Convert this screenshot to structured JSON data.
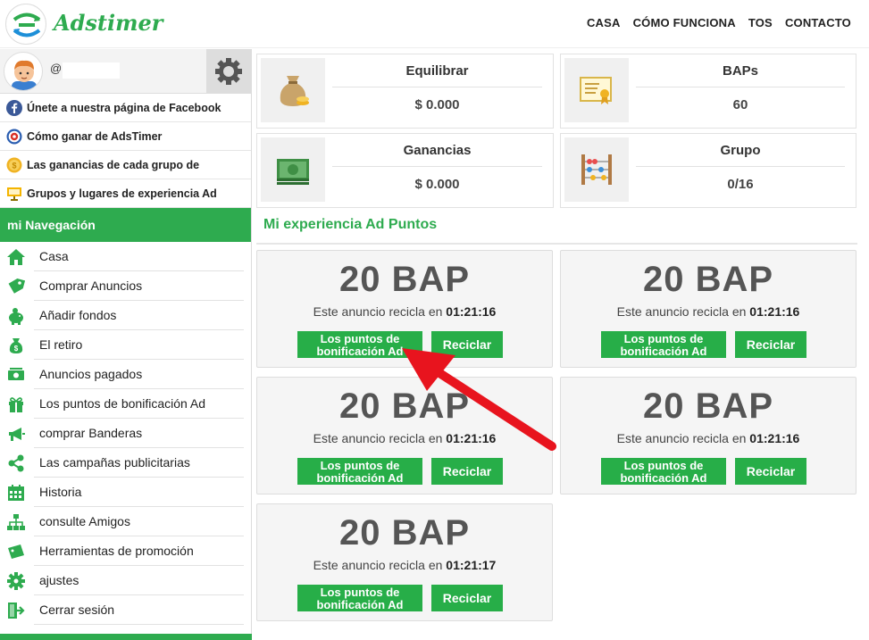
{
  "header": {
    "brand": "Adstimer",
    "nav": [
      "CASA",
      "CÓMO FUNCIONA",
      "TOS",
      "CONTACTO"
    ]
  },
  "profile": {
    "username_prefix": "@"
  },
  "promo_links": [
    {
      "label": "Únete a nuestra página de Facebook",
      "icon": "facebook-icon"
    },
    {
      "label": "Cómo ganar de AdsTimer",
      "icon": "target-icon"
    },
    {
      "label": "Las ganancias de cada grupo de",
      "icon": "coin-icon"
    },
    {
      "label": "Grupos y lugares de experiencia Ad",
      "icon": "presentation-icon"
    }
  ],
  "navigation": {
    "title": "mi Navegación",
    "items": [
      {
        "label": "Casa",
        "icon": "home-icon"
      },
      {
        "label": "Comprar Anuncios",
        "icon": "tag-icon"
      },
      {
        "label": "Añadir fondos",
        "icon": "piggy-bank-icon"
      },
      {
        "label": "El retiro",
        "icon": "money-bag-icon"
      },
      {
        "label": "Anuncios pagados",
        "icon": "cash-icon"
      },
      {
        "label": "Los puntos de bonificación Ad",
        "icon": "gift-icon"
      },
      {
        "label": "comprar Banderas",
        "icon": "megaphone-icon"
      },
      {
        "label": "Las campañas publicitarias",
        "icon": "share-icon"
      },
      {
        "label": "Historia",
        "icon": "calendar-icon"
      },
      {
        "label": "consulte Amigos",
        "icon": "sitemap-icon"
      },
      {
        "label": "Herramientas de promoción",
        "icon": "ticket-icon"
      },
      {
        "label": "ajustes",
        "icon": "cog-icon"
      },
      {
        "label": "Cerrar sesión",
        "icon": "logout-icon"
      }
    ]
  },
  "stats": [
    {
      "label": "Equilibrar",
      "value": "$ 0.000",
      "icon": "money-sack-icon"
    },
    {
      "label": "BAPs",
      "value": "60",
      "icon": "certificate-icon"
    },
    {
      "label": "Ganancias",
      "value": "$ 0.000",
      "icon": "banknotes-icon"
    },
    {
      "label": "Grupo",
      "value": "0/16",
      "icon": "abacus-icon"
    }
  ],
  "section_title": "Mi experiencia Ad Puntos",
  "ads": [
    {
      "bap": "20 BAP",
      "recycle_text": "Este anuncio recicla en",
      "time": "01:21:16",
      "points_btn": "Los puntos de bonificación Ad",
      "recycle_btn": "Reciclar"
    },
    {
      "bap": "20 BAP",
      "recycle_text": "Este anuncio recicla en",
      "time": "01:21:16",
      "points_btn": "Los puntos de bonificación Ad",
      "recycle_btn": "Reciclar"
    },
    {
      "bap": "20 BAP",
      "recycle_text": "Este anuncio recicla en",
      "time": "01:21:16",
      "points_btn": "Los puntos de bonificación Ad",
      "recycle_btn": "Reciclar"
    },
    {
      "bap": "20 BAP",
      "recycle_text": "Este anuncio recicla en",
      "time": "01:21:16",
      "points_btn": "Los puntos de bonificación Ad",
      "recycle_btn": "Reciclar"
    },
    {
      "bap": "20 BAP",
      "recycle_text": "Este anuncio recicla en",
      "time": "01:21:17",
      "points_btn": "Los puntos de bonificación Ad",
      "recycle_btn": "Reciclar"
    }
  ],
  "colors": {
    "accent": "#2eab4f",
    "button": "#27ae48",
    "annotation_arrow": "#e8141e"
  }
}
